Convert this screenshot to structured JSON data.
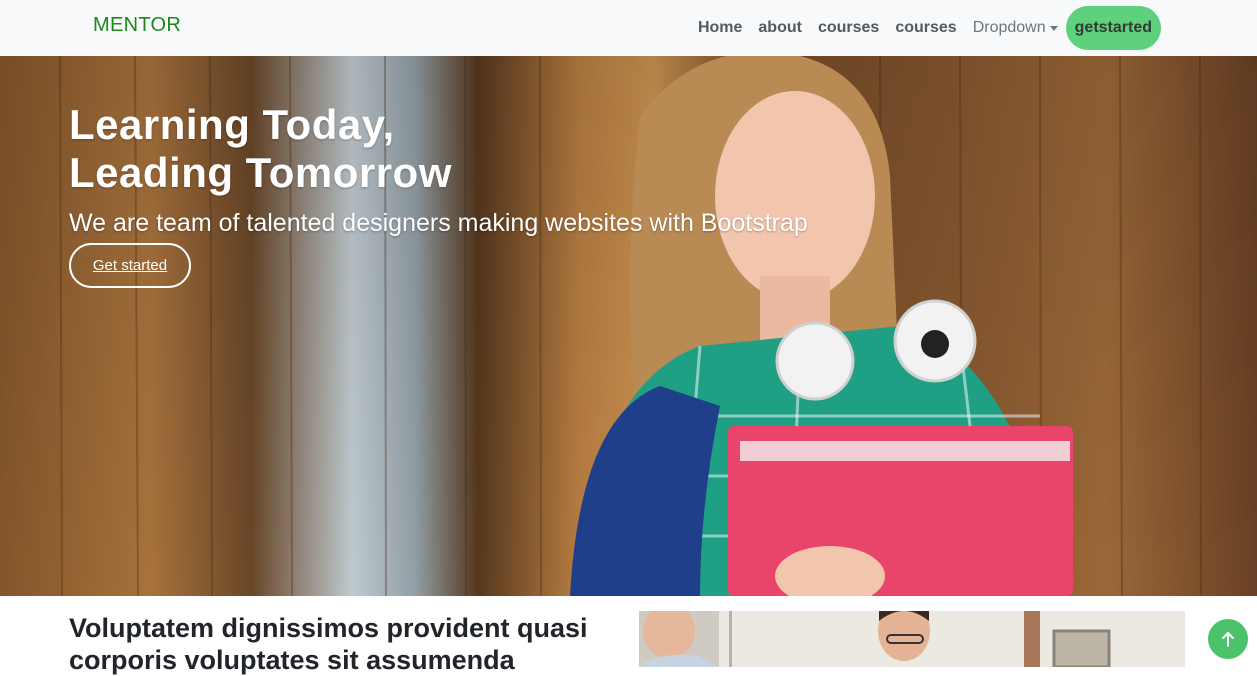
{
  "navbar": {
    "brand": "MENTOR",
    "links": [
      "Home",
      "about",
      "courses",
      "courses"
    ],
    "dropdown_label": "Dropdown",
    "cta_label": "getstarted"
  },
  "hero": {
    "title_line1": "Learning Today,",
    "title_line2": "Leading Tomorrow",
    "subtitle": "We are team of talented designers making websites with Bootstrap",
    "button_label": "Get started"
  },
  "section": {
    "title": "Voluptatem dignissimos provident quasi corporis voluptates sit assumenda"
  },
  "colors": {
    "brand": "#1b8a1b",
    "accent": "#5fd07c",
    "navbar_bg": "#f8f9fa"
  },
  "icons": {
    "back_to_top": "arrow-up-icon",
    "dropdown": "caret-down-icon"
  }
}
